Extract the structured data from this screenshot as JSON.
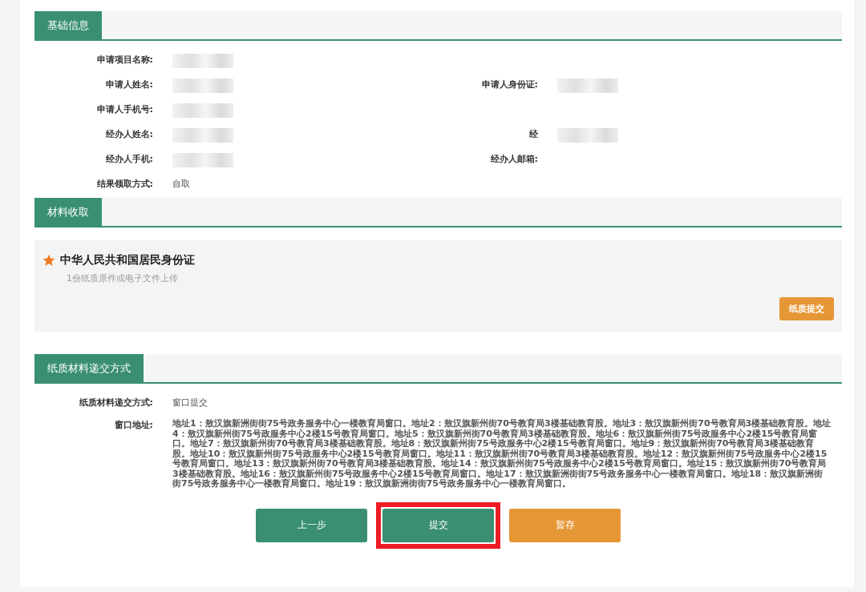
{
  "sections": [
    {
      "kind": "info",
      "title": "基础信息",
      "rows": [
        [
          {
            "label": "申请项目名称:",
            "masked": true
          }
        ],
        [
          {
            "label": "申请人姓名:",
            "masked": true
          },
          {
            "label": "申请人身份证:",
            "masked": true
          }
        ],
        [
          {
            "label": "申请人手机号:",
            "masked": true
          }
        ],
        [
          {
            "label": "经办人姓名:",
            "masked": true
          },
          {
            "label": "经",
            "masked": true
          }
        ],
        [
          {
            "label": "经办人手机:",
            "masked": true
          },
          {
            "label": "经办人邮箱:",
            "masked": false
          }
        ],
        [
          {
            "label": "结果领取方式:",
            "value": "自取",
            "masked": false
          }
        ]
      ]
    },
    {
      "kind": "materials",
      "title": "材料收取",
      "items": [
        {
          "name": "中华人民共和国居民身份证",
          "required": true,
          "hint": "1份纸质原件或电子文件上传",
          "action": "纸质提交"
        }
      ]
    },
    {
      "kind": "info",
      "title": "纸质材料递交方式",
      "rows": [
        [
          {
            "label": "纸质材料递交方式:",
            "value": "窗口提交",
            "masked": false
          }
        ],
        [
          {
            "label": "窗口地址:",
            "value": "地址1：敖汉旗新洲街街75号政务服务中心一楼教育局窗口。地址2：敖汉旗新州街70号教育局3楼基础教育股。地址3：敖汉旗新州街70号教育局3楼基础教育股。地址4：敖汉旗新州街75号政服务中心2楼15号教育局窗口。地址5：敖汉旗新州街70号教育局3楼基础教育股。地址6：敖汉旗新州街75号政服务中心2楼15号教育局窗口。地址7：敖汉旗新州街70号教育局3楼基础教育股。地址8：敖汉旗新州街75号政服务中心2楼15号教育局窗口。地址9：敖汉旗新州街70号教育局3楼基础教育股。地址10：敖汉旗新州街75号政服务中心2楼15号教育局窗口。地址11：敖汉旗新州街70号教育局3楼基础教育股。地址12：敖汉旗新州街75号政服务中心2楼15号教育局窗口。地址13：敖汉旗新州街70号教育局3楼基础教育股。地址14：敖汉旗新州街75号政服务中心2楼15号教育局窗口。地址15：敖汉旗新州街70号教育局3楼基础教育股。地址16：敖汉旗新州街75号政服务中心2楼15号教育局窗口。地址17：敖汉旗新洲街街75号政务服务中心一楼教育局窗口。地址18：敖汉旗新洲街街75号政务服务中心一楼教育局窗口。地址19：敖汉旗新洲街街75号政务服务中心一楼教育局窗口。",
            "masked": false,
            "kind": "long"
          }
        ]
      ]
    }
  ],
  "buttons": [
    {
      "label": "上一步",
      "kind": "primary",
      "highlighted": false
    },
    {
      "label": "提交",
      "kind": "primary",
      "highlighted": true
    },
    {
      "label": "暂存",
      "kind": "warning",
      "highlighted": false
    }
  ]
}
